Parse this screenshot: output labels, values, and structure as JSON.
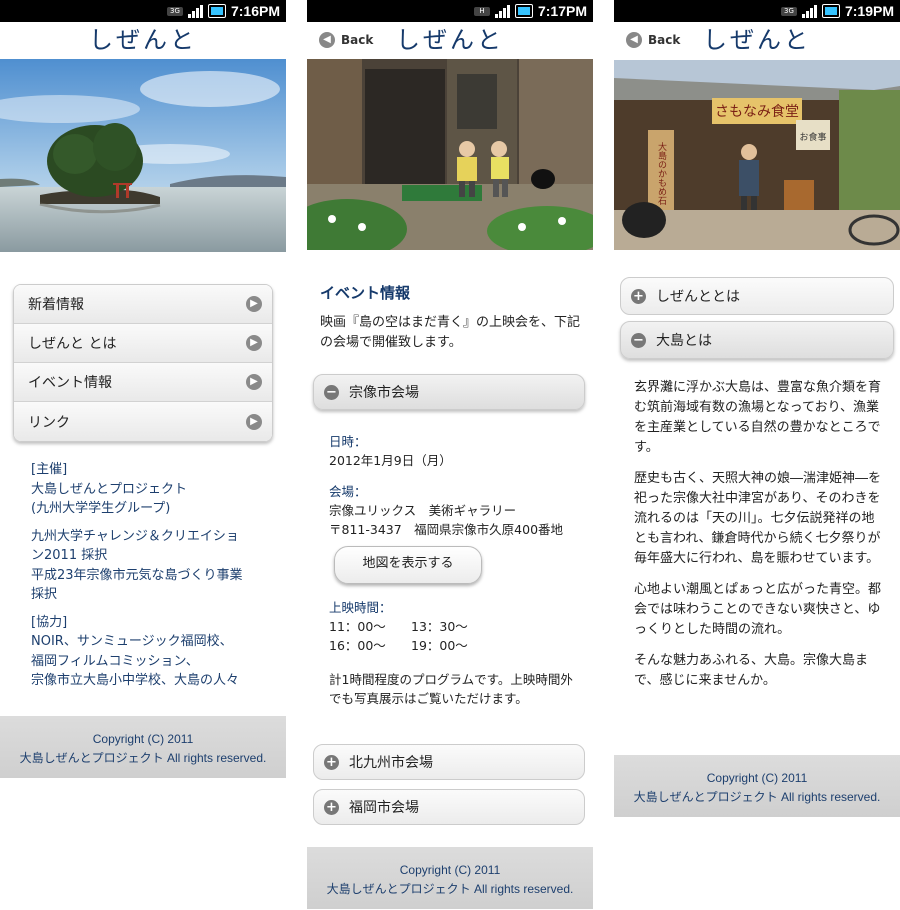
{
  "status_bar": {
    "network_labels": [
      "3G",
      "H",
      "3G"
    ],
    "times": [
      "7:16PM",
      "7:17PM",
      "7:19PM"
    ]
  },
  "app": {
    "title": "しぜんと",
    "back_label": "Back"
  },
  "screen1": {
    "menu": [
      {
        "label": "新着情報"
      },
      {
        "label": "しぜんと とは"
      },
      {
        "label": "イベント情報"
      },
      {
        "label": "リンク"
      }
    ],
    "credits": {
      "organizer_heading": "[主催]",
      "organizer_lines": [
        "大島しぜんとプロジェクト",
        "(九州大学学生グループ)"
      ],
      "program_lines": [
        "九州大学チャレンジ＆クリエイショ",
        "ン2011 採択",
        "平成23年宗像市元気な島づくり事業",
        "採択"
      ],
      "cooperation_heading": "[協力]",
      "cooperation_lines": [
        "NOIR、サンミュージック福岡校、",
        "福岡フィルムコミッション、",
        "宗像市立大島小中学校、大島の人々"
      ]
    }
  },
  "screen2": {
    "section_title": "イベント情報",
    "intro": "映画『島の空はまだ青く』の上映会を、下記の会場で開催致します。",
    "venues": [
      {
        "label": "宗像市会場",
        "expanded": true
      },
      {
        "label": "北九州市会場",
        "expanded": false
      },
      {
        "label": "福岡市会場",
        "expanded": false
      }
    ],
    "event": {
      "date_label": "日時：",
      "date_value": "2012年1月9日（月）",
      "place_label": "会場：",
      "place_name": "宗像ユリックス　美術ギャラリー",
      "place_address": "〒811-3437　福岡県宗像市久原400番地",
      "map_button": "地図を表示する",
      "showtime_label": "上映時間：",
      "showtimes": [
        "11：00～",
        "13：30～",
        "16：00～",
        "19：00～"
      ],
      "note": "計1時間程度のプログラムです。上映時間外でも写真展示はご覧いただけます。"
    }
  },
  "screen3": {
    "sections": [
      {
        "label": "しぜんととは",
        "expanded": false
      },
      {
        "label": "大島とは",
        "expanded": true
      }
    ],
    "paragraphs": [
      "玄界灘に浮かぶ大島は、豊富な魚介類を育む筑前海域有数の漁場となっており、漁業を主産業としている自然の豊かなところです。",
      "歴史も古く、天照大神の娘―湍津姫神―を祀った宗像大社中津宮があり、そのわきを流れるのは「天の川」。七夕伝説発祥の地とも言われ、鎌倉時代から続く七夕祭りが毎年盛大に行われ、島を賑わせています。",
      "心地よい潮風とぱぁっと広がった青空。都会では味わうことのできない爽快さと、ゆっくりとした時間の流れ。",
      "そんな魅力あふれる、大島。宗像大島まで、感じに来ませんか。"
    ],
    "photo_signs": [
      "さもなみ食堂",
      "お食事",
      "大島のかもめ石"
    ]
  },
  "footer": {
    "copyright": "Copyright (C) 2011",
    "owner": "大島しぜんとプロジェクト",
    "rights": " All rights reserved."
  }
}
